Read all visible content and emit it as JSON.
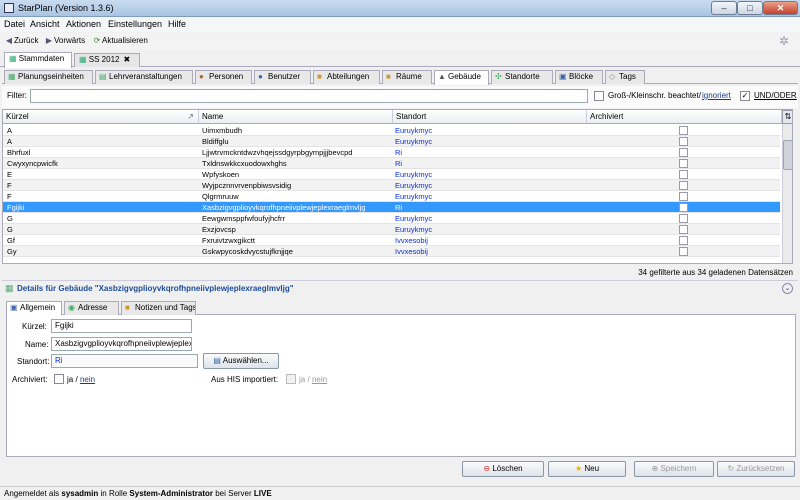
{
  "window": {
    "title": "StarPlan (Version 1.3.6)",
    "min": "–",
    "max": "□",
    "close": "✕"
  },
  "menu": [
    "Datei",
    "Ansicht",
    "Aktionen",
    "Einstellungen",
    "Hilfe"
  ],
  "nav": {
    "back": "Zurück",
    "forward": "Vorwärts",
    "refresh": "Aktualisieren"
  },
  "top_tabs": [
    "Stammdaten",
    "SS 2012"
  ],
  "sub_tabs": [
    "Planungseinheiten",
    "Lehrveranstaltungen",
    "Personen",
    "Benutzer",
    "Abteilungen",
    "Räume",
    "Gebäude",
    "Standorte",
    "Blöcke",
    "Tags"
  ],
  "filter": {
    "label": "Filter:",
    "case_label": "Groß-/Kleinschr. beachtet/",
    "case_link": "ignoriert",
    "and_or": "UND/ODER",
    "value": ""
  },
  "table": {
    "headers": [
      "Kürzel",
      "Name",
      "Standort",
      "Archiviert"
    ],
    "rows": [
      {
        "kuerzel": "A",
        "name": "Uimxmbudh",
        "standort": "Euruykmyc"
      },
      {
        "kuerzel": "A",
        "name": "Bldiffglu",
        "standort": "Euruykmyc"
      },
      {
        "kuerzel": "Bhrfuxl",
        "name": "Ljjwtrvmckntdwzvhqejssdgyrpbgympjjjbevcpd",
        "standort": "Ri"
      },
      {
        "kuerzel": "Cwyxyncpwicfk",
        "name": "Txldnswkkcxuodowxhghs",
        "standort": "Ri"
      },
      {
        "kuerzel": "E",
        "name": "Wpfyskoen",
        "standort": "Euruykmyc"
      },
      {
        "kuerzel": "F",
        "name": "Wyjpcznnvrvenpbiwsvsidig",
        "standort": "Euruykmyc"
      },
      {
        "kuerzel": "F",
        "name": "Qlgrmruuw",
        "standort": "Euruykmyc"
      },
      {
        "kuerzel": "Fgijki",
        "name": "Xasbzigvgplioyvkqrofhpneiivplewjeplexraeglmvljg",
        "standort": "Ri"
      },
      {
        "kuerzel": "G",
        "name": "Eewgwmsppfwfoufyjhcfrr",
        "standort": "Euruykmyc"
      },
      {
        "kuerzel": "G",
        "name": "Exzjovcsp",
        "standort": "Euruykmyc"
      },
      {
        "kuerzel": "Gf",
        "name": "Fxruivtzwxgikctt",
        "standort": "Ivvxesobij"
      },
      {
        "kuerzel": "Gy",
        "name": "Gskwpycoskdvycstujfknjjqe",
        "standort": "Ivvxesobij"
      }
    ],
    "count_text": "34 gefilterte aus 34 geladenen Datensätzen"
  },
  "details": {
    "title": "Details für Gebäude \"Xasbzigvgplioyvkqrofhpneiivplewjeplexraeglmvljg\"",
    "tabs": [
      "Allgemein",
      "Adresse",
      "Notizen und Tags"
    ],
    "labels": {
      "kuerzel": "Kürzel:",
      "name": "Name:",
      "standort": "Standort:",
      "archiviert": "Archiviert:",
      "his": "Aus HIS importiert:"
    },
    "values": {
      "kuerzel": "Fgijki",
      "name": "Xasbzigvgplioyvkqrofhpneiivplewjeplexraeglmvljg",
      "standort": "Ri"
    },
    "choose_btn": "Auswählen...",
    "ja": "ja",
    "slash": "/",
    "nein": "nein"
  },
  "actions": {
    "delete": "Löschen",
    "new": "Neu",
    "save": "Speichern",
    "reset": "Zurücksetzen"
  },
  "status": {
    "prefix": "Angemeldet als ",
    "user": "sysadmin",
    "mid": " in Rolle ",
    "role": "System-Administrator",
    "mid2": " bei Server ",
    "server": "LIVE"
  },
  "colors": {
    "accent": "#3399ff",
    "link": "#0a2fd4"
  }
}
